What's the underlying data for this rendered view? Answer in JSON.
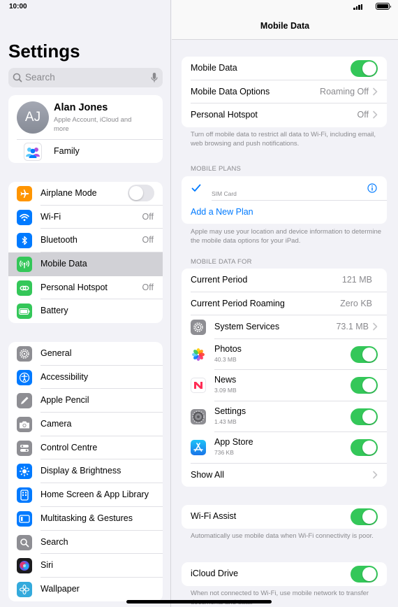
{
  "status": {
    "time": "10:00"
  },
  "sidebar": {
    "title": "Settings",
    "search_placeholder": "Search",
    "profile": {
      "initials": "AJ",
      "name": "Alan Jones",
      "subtitle": "Apple Account, iCloud and more"
    },
    "family_label": "Family",
    "group1": [
      {
        "label": "Airplane Mode",
        "icon": "airplane-icon",
        "color": "#ff9500",
        "toggle": false
      },
      {
        "label": "Wi-Fi",
        "icon": "wifi-icon",
        "color": "#007aff",
        "value": "Off"
      },
      {
        "label": "Bluetooth",
        "icon": "bluetooth-icon",
        "color": "#007aff",
        "value": "Off"
      },
      {
        "label": "Mobile Data",
        "icon": "antenna-icon",
        "color": "#34c759",
        "selected": true
      },
      {
        "label": "Personal Hotspot",
        "icon": "link-icon",
        "color": "#34c759",
        "value": "Off"
      },
      {
        "label": "Battery",
        "icon": "battery-icon",
        "color": "#34c759"
      }
    ],
    "group2": [
      {
        "label": "General",
        "icon": "gear-icon",
        "color": "#8e8e93"
      },
      {
        "label": "Accessibility",
        "icon": "accessibility-icon",
        "color": "#007aff"
      },
      {
        "label": "Apple Pencil",
        "icon": "pencil-icon",
        "color": "#8e8e93"
      },
      {
        "label": "Camera",
        "icon": "camera-icon",
        "color": "#8e8e93"
      },
      {
        "label": "Control Centre",
        "icon": "switches-icon",
        "color": "#8e8e93"
      },
      {
        "label": "Display & Brightness",
        "icon": "sun-icon",
        "color": "#007aff"
      },
      {
        "label": "Home Screen & App Library",
        "icon": "home-screen-icon",
        "color": "#007aff"
      },
      {
        "label": "Multitasking & Gestures",
        "icon": "multitasking-icon",
        "color": "#007aff"
      },
      {
        "label": "Search",
        "icon": "search-icon",
        "color": "#8e8e93"
      },
      {
        "label": "Siri",
        "icon": "siri-icon",
        "color": "#1c1c1e"
      },
      {
        "label": "Wallpaper",
        "icon": "flower-icon",
        "color": "#34aadc"
      }
    ]
  },
  "main": {
    "title": "Mobile Data",
    "top_rows": {
      "mobile_data": "Mobile Data",
      "options_label": "Mobile Data Options",
      "options_value": "Roaming Off",
      "hotspot_label": "Personal Hotspot",
      "hotspot_value": "Off"
    },
    "top_note": "Turn off mobile data to restrict all data to Wi-Fi, including email, web browsing and push notifications.",
    "plans_header": "MOBILE PLANS",
    "sim_label": "SIM Card",
    "add_plan": "Add a New Plan",
    "plans_note": "Apple may use your location and device information to determine the mobile data options for your iPad.",
    "usage_header": "MOBILE DATA FOR",
    "current_period": {
      "label": "Current Period",
      "value": "121 MB"
    },
    "current_roaming": {
      "label": "Current Period Roaming",
      "value": "Zero KB"
    },
    "system_services": {
      "label": "System Services",
      "value": "73.1 MB"
    },
    "apps": [
      {
        "name": "Photos",
        "size": "40.3 MB",
        "icon": "photos-icon",
        "on": true
      },
      {
        "name": "News",
        "size": "3.09 MB",
        "icon": "news-icon",
        "on": true
      },
      {
        "name": "Settings",
        "size": "1.43 MB",
        "icon": "settings-app-icon",
        "on": true
      },
      {
        "name": "App Store",
        "size": "736 KB",
        "icon": "app-store-icon",
        "on": true
      }
    ],
    "show_all": "Show All",
    "wifi_assist": "Wi-Fi Assist",
    "wifi_assist_note": "Automatically use mobile data when Wi-Fi connectivity is poor.",
    "icloud_drive": "iCloud Drive",
    "icloud_note": "When not connected to Wi-Fi, use mobile network to transfer documents and data."
  }
}
